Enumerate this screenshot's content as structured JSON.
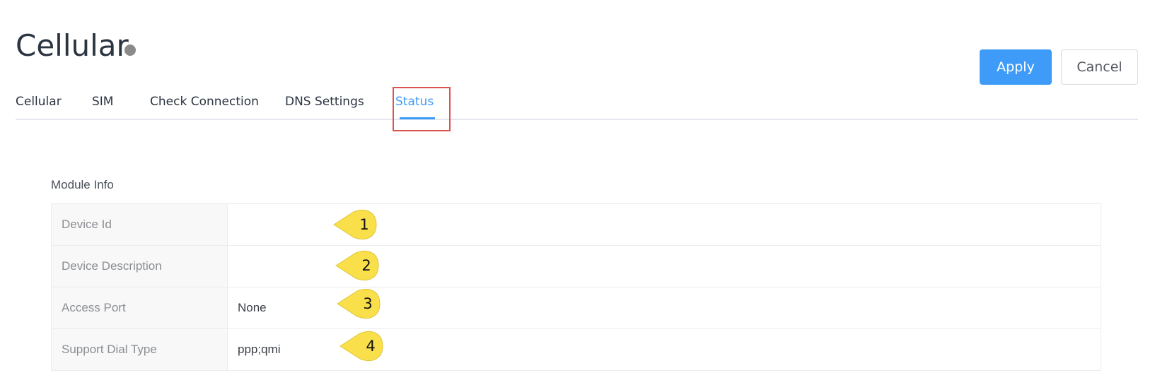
{
  "page": {
    "title": "Cellular"
  },
  "actions": {
    "apply_label": "Apply",
    "cancel_label": "Cancel"
  },
  "tabs": [
    {
      "label": "Cellular",
      "active": false
    },
    {
      "label": "SIM",
      "active": false
    },
    {
      "label": "Check Connection",
      "active": false
    },
    {
      "label": "DNS Settings",
      "active": false
    },
    {
      "label": "Status",
      "active": true
    }
  ],
  "module_info": {
    "heading": "Module Info",
    "rows": [
      {
        "label": "Device Id",
        "value": ""
      },
      {
        "label": "Device Description",
        "value": ""
      },
      {
        "label": "Access Port",
        "value": "None"
      },
      {
        "label": "Support Dial Type",
        "value": "ppp;qmi"
      }
    ]
  },
  "callouts": [
    "1",
    "2",
    "3",
    "4"
  ],
  "colors": {
    "accent": "#3e9bf7",
    "highlight_border": "#d9534f",
    "callout_fill": "#f9e04b",
    "status_dot": "#8a8a8a"
  },
  "icons": {
    "status_indicator": "status-dot-icon",
    "callout": "callout-marker-icon"
  }
}
